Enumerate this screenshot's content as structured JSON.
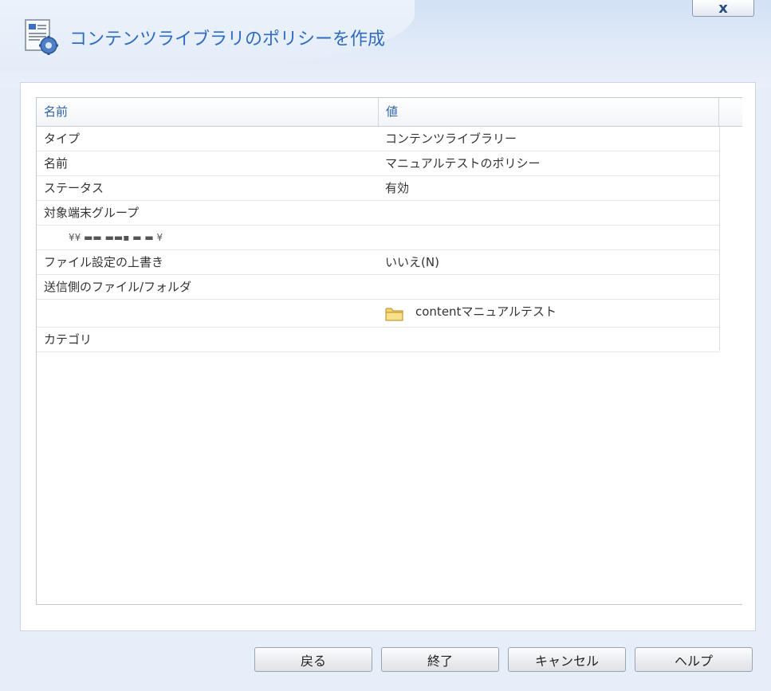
{
  "window": {
    "title": "コンテンツライブラリのポリシーを作成",
    "close_label": "x"
  },
  "grid": {
    "columns": [
      "名前",
      "値"
    ],
    "rows": [
      {
        "name": "タイプ",
        "value": "コンテンツライブラリー"
      },
      {
        "name": "名前",
        "value": "マニュアルテストのポリシー"
      },
      {
        "name": "ステータス",
        "value": "有効"
      },
      {
        "name": "対象端末グループ",
        "value": ""
      },
      {
        "name": "¥¥ ▬▬ ▬▬▪ ▬ ▬ ¥",
        "value": ""
      },
      {
        "name": "ファイル設定の上書き",
        "value": "いいえ(N)"
      },
      {
        "name": "送信側のファイル/フォルダ",
        "value": ""
      },
      {
        "name": "",
        "value": "contentマニュアルテスト",
        "icon": "folder-icon"
      },
      {
        "name": "カテゴリ",
        "value": ""
      }
    ]
  },
  "buttons": {
    "back": "戻る",
    "finish": "終了",
    "cancel": "キャンセル",
    "help": "ヘルプ"
  },
  "colors": {
    "title": "#2f6cc1",
    "header_text": "#2e62ad",
    "background": "#e6eef9"
  }
}
